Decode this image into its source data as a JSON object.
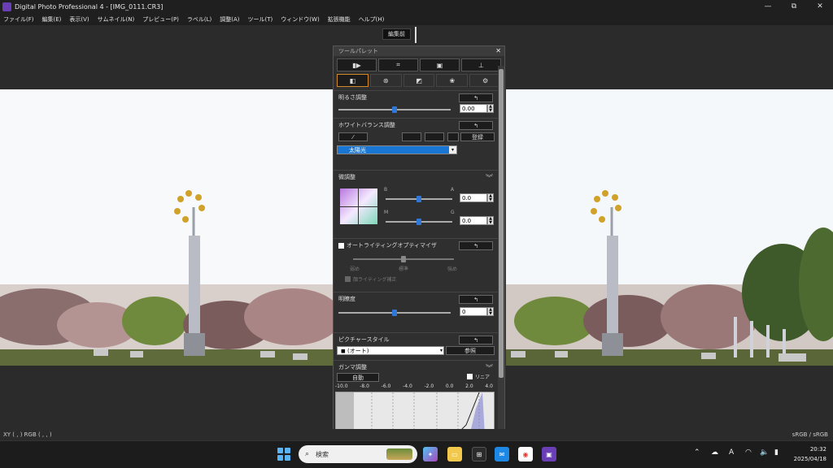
{
  "window": {
    "title": "Digital Photo Professional 4 - [IMG_0111.CR3]",
    "controls": [
      "—",
      "⧉",
      "✕"
    ]
  },
  "menu": [
    "ファイル(F)",
    "編集(E)",
    "表示(V)",
    "サムネイル(N)",
    "プレビュー(P)",
    "ラベル(L)",
    "調整(A)",
    "ツール(T)",
    "ウィンドウ(W)",
    "拡張機能",
    "ヘルプ(H)"
  ],
  "toolbar": {
    "before_label": "編集前"
  },
  "palette": {
    "title": "ツールパレット",
    "tabs_row1": [
      "▮▶",
      "⌗",
      "▣",
      "⊥"
    ],
    "tabs_row2": [
      "◧",
      "⊛",
      "◩",
      "❀",
      "⚙"
    ],
    "brightness": {
      "title": "明るさ調整",
      "value": "0.00",
      "level": 0.5
    },
    "white_balance": {
      "title": "ホワイトバランス調整",
      "register": "登録",
      "preset": "太陽光"
    },
    "fine_tune": {
      "title": "微調整",
      "label_b": "B",
      "label_a": "A",
      "label_m": "M",
      "label_g": "G",
      "value_ba": "0.0",
      "value_mg": "0.0"
    },
    "alo": {
      "title": "オートライティングオプティマイザ",
      "levels": [
        "弱め",
        "標準",
        "強め"
      ],
      "sub": "顔ライティング補正"
    },
    "clarity": {
      "title": "明瞭度",
      "value": "0"
    },
    "picture_style": {
      "title": "ピクチャースタイル",
      "value": "(オート)",
      "browse": "参照"
    },
    "gamma": {
      "title": "ガンマ調整",
      "auto": "自動",
      "linear": "リニア",
      "ticks": [
        "-10.0",
        "-8.0",
        "-6.0",
        "-4.0",
        "-2.0",
        "0.0",
        "2.0",
        "4.0"
      ]
    },
    "reset_icon": "↰"
  },
  "status": {
    "left": "XY ( , ) RGB ( , , )",
    "right": "sRGB / sRGB"
  },
  "taskbar": {
    "search": "検索",
    "time": "20:32",
    "date": "2025/04/18",
    "ime": "A"
  }
}
